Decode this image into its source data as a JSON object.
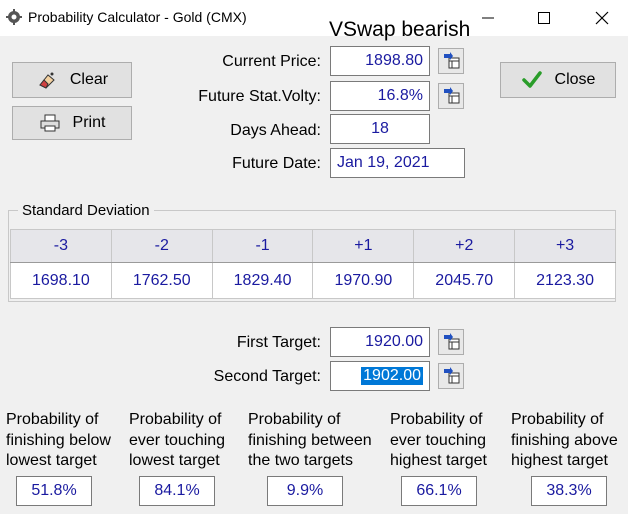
{
  "window": {
    "title": "Probability Calculator - Gold (CMX)",
    "overlay_text": "VSwap bearish"
  },
  "buttons": {
    "clear": "Clear",
    "print": "Print",
    "close": "Close"
  },
  "inputs": {
    "current_price": {
      "label": "Current Price:",
      "value": "1898.80"
    },
    "future_volty": {
      "label": "Future Stat.Volty:",
      "value": "16.8%"
    },
    "days_ahead": {
      "label": "Days Ahead:",
      "value": "18"
    },
    "future_date": {
      "label": "Future Date:",
      "value": "Jan 19, 2021"
    }
  },
  "std_dev": {
    "title": "Standard Deviation",
    "headers": [
      "-3",
      "-2",
      "-1",
      "+1",
      "+2",
      "+3"
    ],
    "values": [
      "1698.10",
      "1762.50",
      "1829.40",
      "1970.90",
      "2045.70",
      "2123.30"
    ]
  },
  "targets": {
    "first": {
      "label": "First Target:",
      "value": "1920.00"
    },
    "second": {
      "label": "Second Target:",
      "value": "1902.00"
    }
  },
  "probabilities": [
    {
      "lines": [
        "Probability of",
        "finishing below",
        "lowest target"
      ],
      "value": "51.8%"
    },
    {
      "lines": [
        "Probability of",
        "ever touching",
        "lowest target"
      ],
      "value": "84.1%"
    },
    {
      "lines": [
        "Probability of",
        "finishing between",
        "the two targets"
      ],
      "value": "9.9%"
    },
    {
      "lines": [
        "Probability of",
        "ever touching",
        "highest target"
      ],
      "value": "66.1%"
    },
    {
      "lines": [
        "Probability of",
        "finishing above",
        "highest target"
      ],
      "value": "38.3%"
    }
  ],
  "colors": {
    "value_text": "#1a1aa0",
    "selection": "#0078d7",
    "check": "#2a9d2a"
  }
}
